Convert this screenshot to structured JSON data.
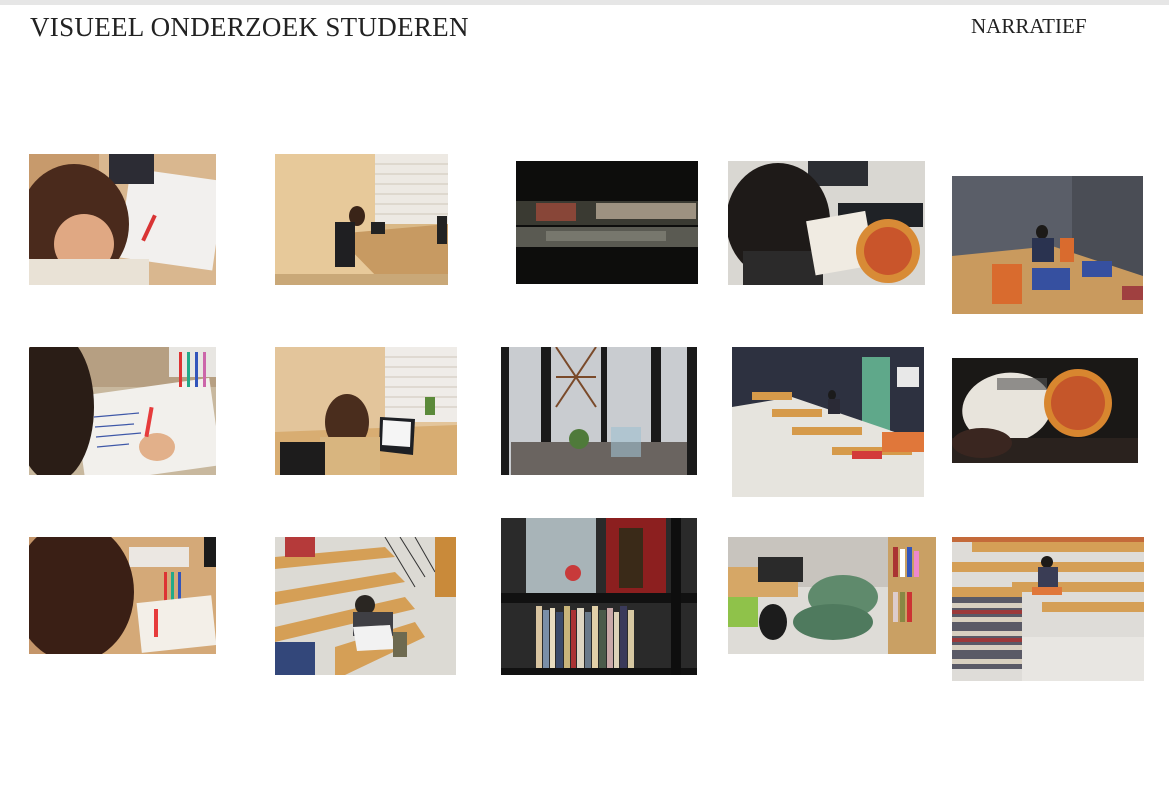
{
  "header": {
    "title": "VISUEEL ONDERZOEK STUDEREN",
    "label": "NARRATIEF"
  },
  "photos": [
    {
      "id": "p1",
      "icon": "student-writing-notes-photo"
    },
    {
      "id": "p2",
      "icon": "student-at-desk-window-photo"
    },
    {
      "id": "p3",
      "icon": "blurred-bookshelf-photo"
    },
    {
      "id": "p4",
      "icon": "reading-pizza-book-photo"
    },
    {
      "id": "p5",
      "icon": "student-study-niche-photo"
    },
    {
      "id": "p6",
      "icon": "writing-notebook-photo"
    },
    {
      "id": "p7",
      "icon": "student-laptop-window-photo"
    },
    {
      "id": "p8",
      "icon": "library-hall-photo"
    },
    {
      "id": "p9",
      "icon": "study-stairs-photo"
    },
    {
      "id": "p10",
      "icon": "pizza-book-closeup-photo"
    },
    {
      "id": "p11",
      "icon": "student-writing-closeup-photo"
    },
    {
      "id": "p12",
      "icon": "student-on-stairs-photo"
    },
    {
      "id": "p13",
      "icon": "bookshelf-photo"
    },
    {
      "id": "p14",
      "icon": "green-chair-photo"
    },
    {
      "id": "p15",
      "icon": "student-on-bookstack-stairs-photo"
    }
  ]
}
